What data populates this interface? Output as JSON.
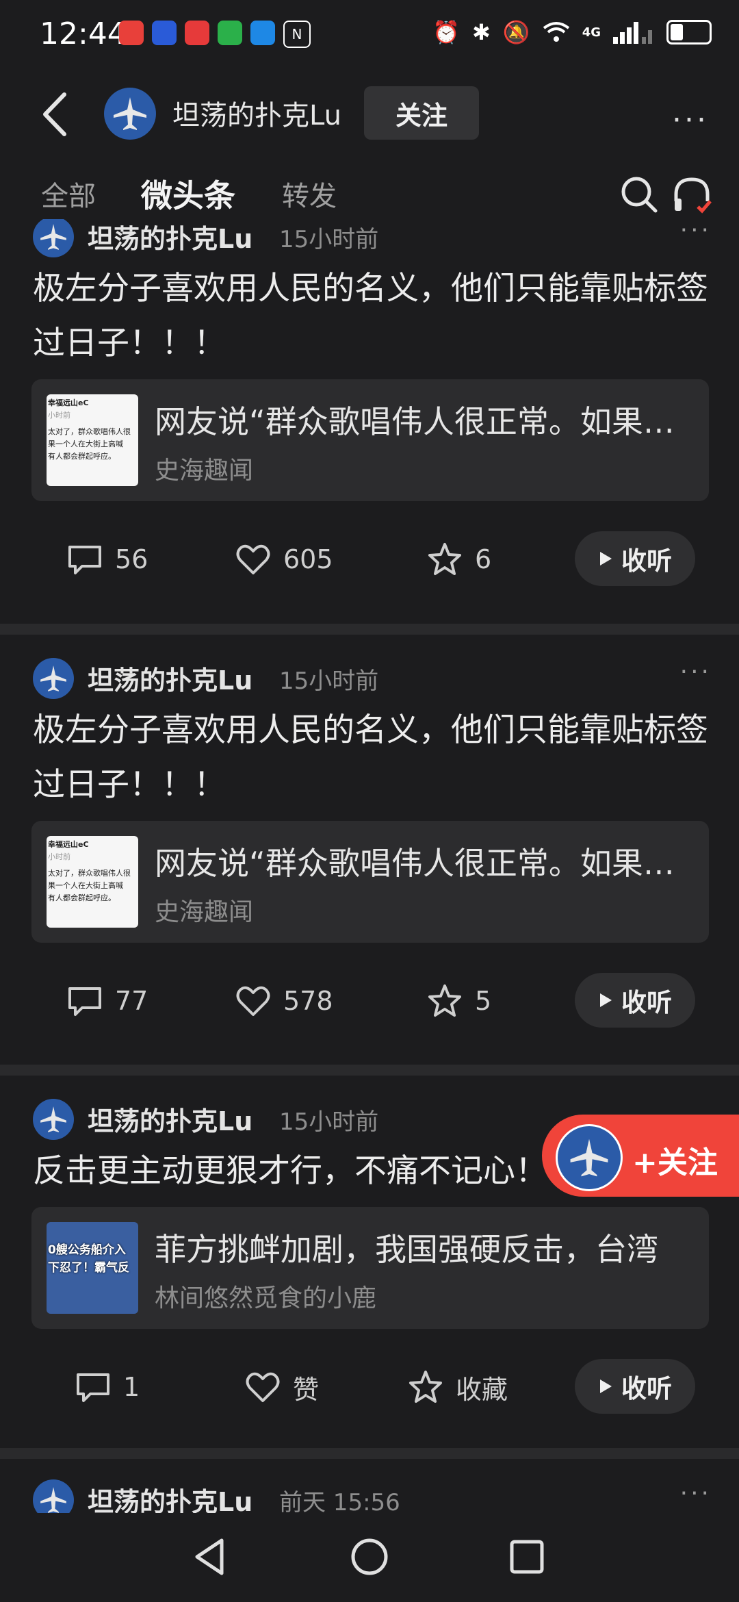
{
  "status_bar": {
    "time": "12:44",
    "network": "4G",
    "icons": [
      "alarm-icon",
      "bluetooth-icon",
      "mute-icon",
      "wifi-icon",
      "signal-icon",
      "battery-icon"
    ]
  },
  "header": {
    "profile_name": "坦荡的扑克Lu",
    "follow_label": "关注",
    "more_label": "···"
  },
  "tabs": [
    {
      "label": "全部",
      "active": false
    },
    {
      "label": "微头条",
      "active": true
    },
    {
      "label": "转发",
      "active": false
    }
  ],
  "posts": [
    {
      "author": "坦荡的扑克Lu",
      "time": "15小时前",
      "text": "极左分子喜欢用人民的名义，他们只能靠贴标签过日子！！！",
      "card": {
        "title": "网友说“群众歌唱伟人很正常。如果一个人在大街上高喊",
        "source": "史海趣闻",
        "thumb_lines": [
          "幸福远山eC",
          "小时前",
          "太对了，群众歌唱伟人很",
          "果一个人在大街上高喊",
          "有人都会群起呼应。"
        ]
      },
      "comments": "56",
      "likes": "605",
      "favorites": "6",
      "listen": "收听"
    },
    {
      "author": "坦荡的扑克Lu",
      "time": "15小时前",
      "text": "极左分子喜欢用人民的名义，他们只能靠贴标签过日子！！！",
      "card": {
        "title": "网友说“群众歌唱伟人很正常。如果一个人在大街上高喊",
        "source": "史海趣闻",
        "thumb_lines": [
          "幸福远山eC",
          "小时前",
          "太对了，群众歌唱伟人很",
          "果一个人在大街上高喊",
          "有人都会群起呼应。"
        ]
      },
      "comments": "77",
      "likes": "578",
      "favorites": "5",
      "listen": "收听"
    },
    {
      "author": "坦荡的扑克Lu",
      "time": "15小时前",
      "text": "反击更主动更狠才行，不痛不记心！！！",
      "card": {
        "title": "菲方挑衅加剧，我国强硬反击，台湾",
        "source": "林间悠然觅食的小鹿",
        "thumb_lines": [
          "0艘公务船介入",
          "下忍了！霸气反"
        ]
      },
      "comments": "1",
      "likes": "赞",
      "favorites": "收藏",
      "listen": "收听"
    },
    {
      "author": "坦荡的扑克Lu",
      "time": "前天 15:56"
    }
  ],
  "float_follow": {
    "label": "+关注"
  },
  "colors": {
    "background": "#1c1c1e",
    "card": "#2c2c2e",
    "accent": "#f0443a",
    "avatar": "#2b5ba8"
  }
}
